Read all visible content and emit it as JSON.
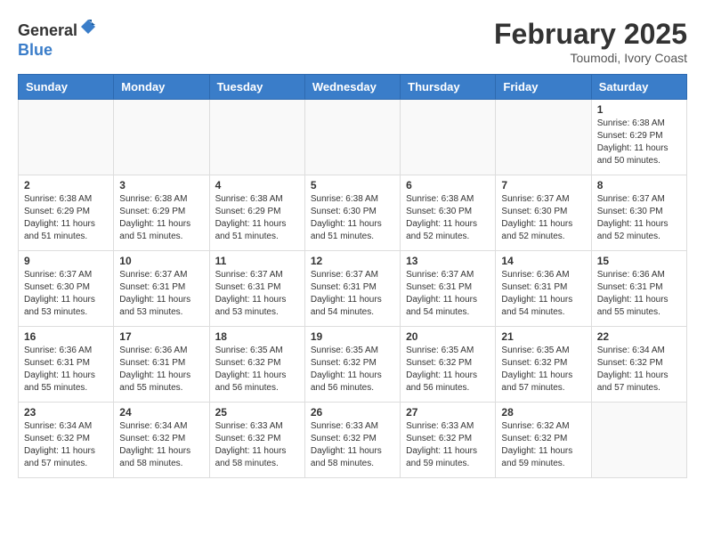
{
  "header": {
    "logo_general": "General",
    "logo_blue": "Blue",
    "month_title": "February 2025",
    "location": "Toumodi, Ivory Coast"
  },
  "days_of_week": [
    "Sunday",
    "Monday",
    "Tuesday",
    "Wednesday",
    "Thursday",
    "Friday",
    "Saturday"
  ],
  "weeks": [
    [
      {
        "day": "",
        "info": ""
      },
      {
        "day": "",
        "info": ""
      },
      {
        "day": "",
        "info": ""
      },
      {
        "day": "",
        "info": ""
      },
      {
        "day": "",
        "info": ""
      },
      {
        "day": "",
        "info": ""
      },
      {
        "day": "1",
        "info": "Sunrise: 6:38 AM\nSunset: 6:29 PM\nDaylight: 11 hours\nand 50 minutes."
      }
    ],
    [
      {
        "day": "2",
        "info": "Sunrise: 6:38 AM\nSunset: 6:29 PM\nDaylight: 11 hours\nand 51 minutes."
      },
      {
        "day": "3",
        "info": "Sunrise: 6:38 AM\nSunset: 6:29 PM\nDaylight: 11 hours\nand 51 minutes."
      },
      {
        "day": "4",
        "info": "Sunrise: 6:38 AM\nSunset: 6:29 PM\nDaylight: 11 hours\nand 51 minutes."
      },
      {
        "day": "5",
        "info": "Sunrise: 6:38 AM\nSunset: 6:30 PM\nDaylight: 11 hours\nand 51 minutes."
      },
      {
        "day": "6",
        "info": "Sunrise: 6:38 AM\nSunset: 6:30 PM\nDaylight: 11 hours\nand 52 minutes."
      },
      {
        "day": "7",
        "info": "Sunrise: 6:37 AM\nSunset: 6:30 PM\nDaylight: 11 hours\nand 52 minutes."
      },
      {
        "day": "8",
        "info": "Sunrise: 6:37 AM\nSunset: 6:30 PM\nDaylight: 11 hours\nand 52 minutes."
      }
    ],
    [
      {
        "day": "9",
        "info": "Sunrise: 6:37 AM\nSunset: 6:30 PM\nDaylight: 11 hours\nand 53 minutes."
      },
      {
        "day": "10",
        "info": "Sunrise: 6:37 AM\nSunset: 6:31 PM\nDaylight: 11 hours\nand 53 minutes."
      },
      {
        "day": "11",
        "info": "Sunrise: 6:37 AM\nSunset: 6:31 PM\nDaylight: 11 hours\nand 53 minutes."
      },
      {
        "day": "12",
        "info": "Sunrise: 6:37 AM\nSunset: 6:31 PM\nDaylight: 11 hours\nand 54 minutes."
      },
      {
        "day": "13",
        "info": "Sunrise: 6:37 AM\nSunset: 6:31 PM\nDaylight: 11 hours\nand 54 minutes."
      },
      {
        "day": "14",
        "info": "Sunrise: 6:36 AM\nSunset: 6:31 PM\nDaylight: 11 hours\nand 54 minutes."
      },
      {
        "day": "15",
        "info": "Sunrise: 6:36 AM\nSunset: 6:31 PM\nDaylight: 11 hours\nand 55 minutes."
      }
    ],
    [
      {
        "day": "16",
        "info": "Sunrise: 6:36 AM\nSunset: 6:31 PM\nDaylight: 11 hours\nand 55 minutes."
      },
      {
        "day": "17",
        "info": "Sunrise: 6:36 AM\nSunset: 6:31 PM\nDaylight: 11 hours\nand 55 minutes."
      },
      {
        "day": "18",
        "info": "Sunrise: 6:35 AM\nSunset: 6:32 PM\nDaylight: 11 hours\nand 56 minutes."
      },
      {
        "day": "19",
        "info": "Sunrise: 6:35 AM\nSunset: 6:32 PM\nDaylight: 11 hours\nand 56 minutes."
      },
      {
        "day": "20",
        "info": "Sunrise: 6:35 AM\nSunset: 6:32 PM\nDaylight: 11 hours\nand 56 minutes."
      },
      {
        "day": "21",
        "info": "Sunrise: 6:35 AM\nSunset: 6:32 PM\nDaylight: 11 hours\nand 57 minutes."
      },
      {
        "day": "22",
        "info": "Sunrise: 6:34 AM\nSunset: 6:32 PM\nDaylight: 11 hours\nand 57 minutes."
      }
    ],
    [
      {
        "day": "23",
        "info": "Sunrise: 6:34 AM\nSunset: 6:32 PM\nDaylight: 11 hours\nand 57 minutes."
      },
      {
        "day": "24",
        "info": "Sunrise: 6:34 AM\nSunset: 6:32 PM\nDaylight: 11 hours\nand 58 minutes."
      },
      {
        "day": "25",
        "info": "Sunrise: 6:33 AM\nSunset: 6:32 PM\nDaylight: 11 hours\nand 58 minutes."
      },
      {
        "day": "26",
        "info": "Sunrise: 6:33 AM\nSunset: 6:32 PM\nDaylight: 11 hours\nand 58 minutes."
      },
      {
        "day": "27",
        "info": "Sunrise: 6:33 AM\nSunset: 6:32 PM\nDaylight: 11 hours\nand 59 minutes."
      },
      {
        "day": "28",
        "info": "Sunrise: 6:32 AM\nSunset: 6:32 PM\nDaylight: 11 hours\nand 59 minutes."
      },
      {
        "day": "",
        "info": ""
      }
    ]
  ]
}
